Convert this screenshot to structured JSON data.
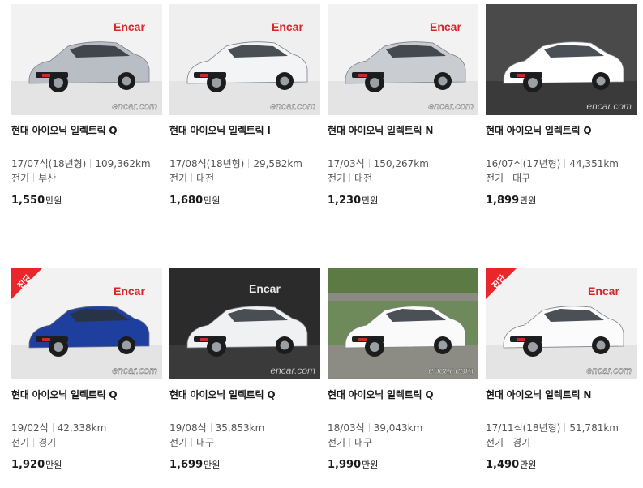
{
  "brand_watermark": "encar.com",
  "brand_logo": "Encar",
  "badge_label": "진단",
  "listings": [
    {
      "title": "현대 아이오닉 일렉트릭 Q",
      "year": "17/07식(18년형)",
      "mileage": "109,362km",
      "fuel": "전기",
      "region": "부산",
      "price": "1,550",
      "unit": "만원",
      "car_color": "#b9bec4",
      "bg": "#f2f2f2",
      "badge": false
    },
    {
      "title": "현대 아이오닉 일렉트릭 I",
      "year": "17/08식(18년형)",
      "mileage": "29,582km",
      "fuel": "전기",
      "region": "대전",
      "price": "1,680",
      "unit": "만원",
      "car_color": "#f3f4f6",
      "bg": "#efefef",
      "badge": false
    },
    {
      "title": "현대 아이오닉 일렉트릭 N",
      "year": "17/03식",
      "mileage": "150,267km",
      "fuel": "전기",
      "region": "대전",
      "price": "1,230",
      "unit": "만원",
      "car_color": "#c9ccd0",
      "bg": "#f2f2f2",
      "badge": false
    },
    {
      "title": "현대 아이오닉 일렉트릭 Q",
      "year": "16/07식(17년형)",
      "mileage": "44,351km",
      "fuel": "전기",
      "region": "대구",
      "price": "1,899",
      "unit": "만원",
      "car_color": "#ffffff",
      "bg": "#4a4a4a",
      "badge": false
    },
    {
      "title": "현대 아이오닉 일렉트릭 Q",
      "year": "19/02식",
      "mileage": "42,338km",
      "fuel": "전기",
      "region": "경기",
      "price": "1,920",
      "unit": "만원",
      "car_color": "#1f3f9e",
      "bg": "#f2f2f2",
      "badge": true
    },
    {
      "title": "현대 아이오닉 일렉트릭 Q",
      "year": "19/08식",
      "mileage": "35,853km",
      "fuel": "전기",
      "region": "대구",
      "price": "1,699",
      "unit": "만원",
      "car_color": "#f0f1f3",
      "bg": "#2b2b2b",
      "badge": false
    },
    {
      "title": "현대 아이오닉 일렉트릭 Q",
      "year": "18/03식",
      "mileage": "39,043km",
      "fuel": "전기",
      "region": "대구",
      "price": "1,990",
      "unit": "만원",
      "car_color": "#fafafa",
      "bg": "#6f8a5a",
      "badge": false
    },
    {
      "title": "현대 아이오닉 일렉트릭 N",
      "year": "17/11식(18년형)",
      "mileage": "51,781km",
      "fuel": "전기",
      "region": "경기",
      "price": "1,490",
      "unit": "만원",
      "car_color": "#fbfbfb",
      "bg": "#f2f2f2",
      "badge": true
    }
  ]
}
